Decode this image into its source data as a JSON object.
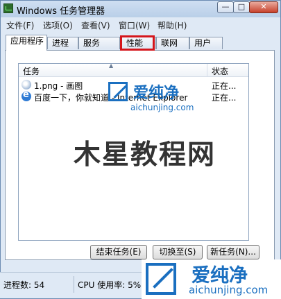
{
  "window": {
    "title": "Windows 任务管理器",
    "controls": {
      "minimize": "—",
      "maximize": "□",
      "close": "✕"
    }
  },
  "menu": [
    "文件(F)",
    "选项(O)",
    "查看(V)",
    "窗口(W)",
    "帮助(H)"
  ],
  "tabs": [
    "应用程序",
    "进程",
    "服务",
    "性能",
    "联网",
    "用户"
  ],
  "active_tab": "应用程序",
  "highlighted_tab": "性能",
  "highlight_color": "#d4151b",
  "list": {
    "columns": {
      "task": "任务",
      "status": "状态"
    },
    "rows": [
      {
        "icon": "paint-icon",
        "task": "1.png - 画图",
        "status": "正在..."
      },
      {
        "icon": "ie-icon",
        "task": "百度一下，你就知道 - Internet Explorer",
        "status": "正在..."
      }
    ]
  },
  "buttons": {
    "end_task": "结束任务(E)",
    "switch_to": "切换至(S)",
    "new_task": "新任务(N)..."
  },
  "statusbar": {
    "processes": "进程数: 54",
    "cpu": "CPU 使用率: 5%"
  },
  "watermarks": {
    "site_name": "爱纯净",
    "site_url": "aichunjing.com",
    "big_text": "木星教程网",
    "accent": "#1a6fc0"
  }
}
